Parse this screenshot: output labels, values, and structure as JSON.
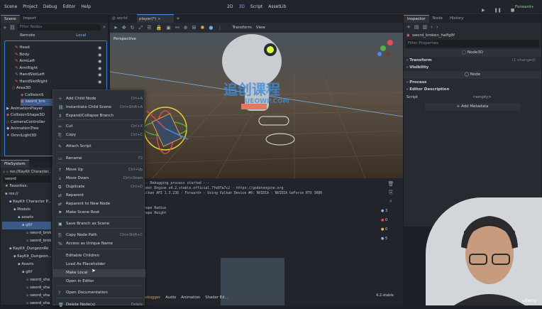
{
  "menubar": {
    "items": [
      "Scene",
      "Project",
      "Debug",
      "Editor",
      "Help"
    ],
    "workspace": [
      "2D",
      "3D",
      "Script",
      "AssetLib"
    ],
    "renderer": "Forward+"
  },
  "scene_dock": {
    "tabs": [
      "Scene",
      "Import"
    ],
    "filter_placeholder": "Filter Nodes",
    "remote": "Remote",
    "local": "Local",
    "nodes": [
      "Head",
      "Body",
      "ArmLeft",
      "ArmRight",
      "HandSlotLeft",
      "HandSlotRight",
      "Area3D",
      "CollisionS",
      "sword_bro",
      "AnimationPlayer",
      "CollisionShape3D",
      "CameraController",
      "AnimationTree",
      "OmniLight3D"
    ]
  },
  "filesystem": {
    "tab": "FileSystem",
    "path": "res://KayKit Character...",
    "search": "sword",
    "items": [
      "Favorites:",
      "res://",
      "KayKit Character P...",
      "Models",
      "assets",
      "gltf",
      "sword_brok",
      "sword_brok",
      "KayKit_DungeonRe",
      "KayKit_Dungeon...",
      "Assets",
      "gltf",
      "sword_sha",
      "sword_sha",
      "sword_sha",
      "sword_sha"
    ]
  },
  "scene_tabs": {
    "tabs": [
      "world",
      "player(*)"
    ]
  },
  "viewport": {
    "label": "Perspective",
    "toolbar": [
      "Transform",
      "View"
    ]
  },
  "watermark": {
    "title": "追创课程",
    "url": "UEOWP.COM"
  },
  "context_menu": {
    "items": [
      {
        "label": "Add Child Node",
        "sc": "Ctrl+A"
      },
      {
        "label": "Instantiate Child Scene",
        "sc": "Ctrl+Shift+A"
      },
      {
        "label": "Expand/Collapse Branch",
        "sc": ""
      },
      {
        "label": "Cut",
        "sc": "Ctrl+X"
      },
      {
        "label": "Copy",
        "sc": "Ctrl+C"
      },
      {
        "label": "Attach Script",
        "sc": ""
      },
      {
        "label": "Rename",
        "sc": "F2"
      },
      {
        "label": "Move Up",
        "sc": "Ctrl+Up"
      },
      {
        "label": "Move Down",
        "sc": "Ctrl+Down"
      },
      {
        "label": "Duplicate",
        "sc": "Ctrl+D"
      },
      {
        "label": "Reparent",
        "sc": ""
      },
      {
        "label": "Reparent to New Node",
        "sc": ""
      },
      {
        "label": "Make Scene Root",
        "sc": ""
      },
      {
        "label": "Save Branch as Scene",
        "sc": ""
      },
      {
        "label": "Copy Node Path",
        "sc": "Ctrl+Shift+C"
      },
      {
        "label": "Access as Unique Name",
        "sc": ""
      },
      {
        "label": "Editable Children",
        "sc": ""
      },
      {
        "label": "Load As Placeholder",
        "sc": ""
      },
      {
        "label": "Make Local",
        "sc": ""
      },
      {
        "label": "Open in Editor",
        "sc": ""
      },
      {
        "label": "Open Documentation",
        "sc": ""
      },
      {
        "label": "Delete Node(s)",
        "sc": "Delete"
      }
    ]
  },
  "output": {
    "lines": [
      "--- Debugging process started ---",
      "Godot Engine v4.2.stable.official.7fe97a7c2 - https://godotengine.org",
      "Vulkan API 1.3.236 - Forward+ - Using Vulkan Device #0: NVIDIA - NVIDIA GeForce RTX 3080",
      "",
      "",
      "Shape Radius",
      "Shape Height"
    ],
    "tabs": [
      "Debugger",
      "Audio",
      "Animation",
      "Shader Ed..."
    ],
    "version": "4.2.stable",
    "badges": [
      "3",
      "0",
      "0",
      "5"
    ]
  },
  "inspector": {
    "tabs": [
      "Inspector",
      "Node",
      "History"
    ],
    "resource": "sword_broken_halfgltf",
    "filter": "Filter Properties",
    "node_type": "Node3D",
    "sections": [
      "Transform",
      "Visibility"
    ],
    "changed": "(1 changed)",
    "node_header": "Node",
    "sub": [
      "Process",
      "Editor Description"
    ],
    "script_label": "Script",
    "script_value": "<empty>",
    "add_metadata": "Add Metadata"
  },
  "udemy": "udemy"
}
